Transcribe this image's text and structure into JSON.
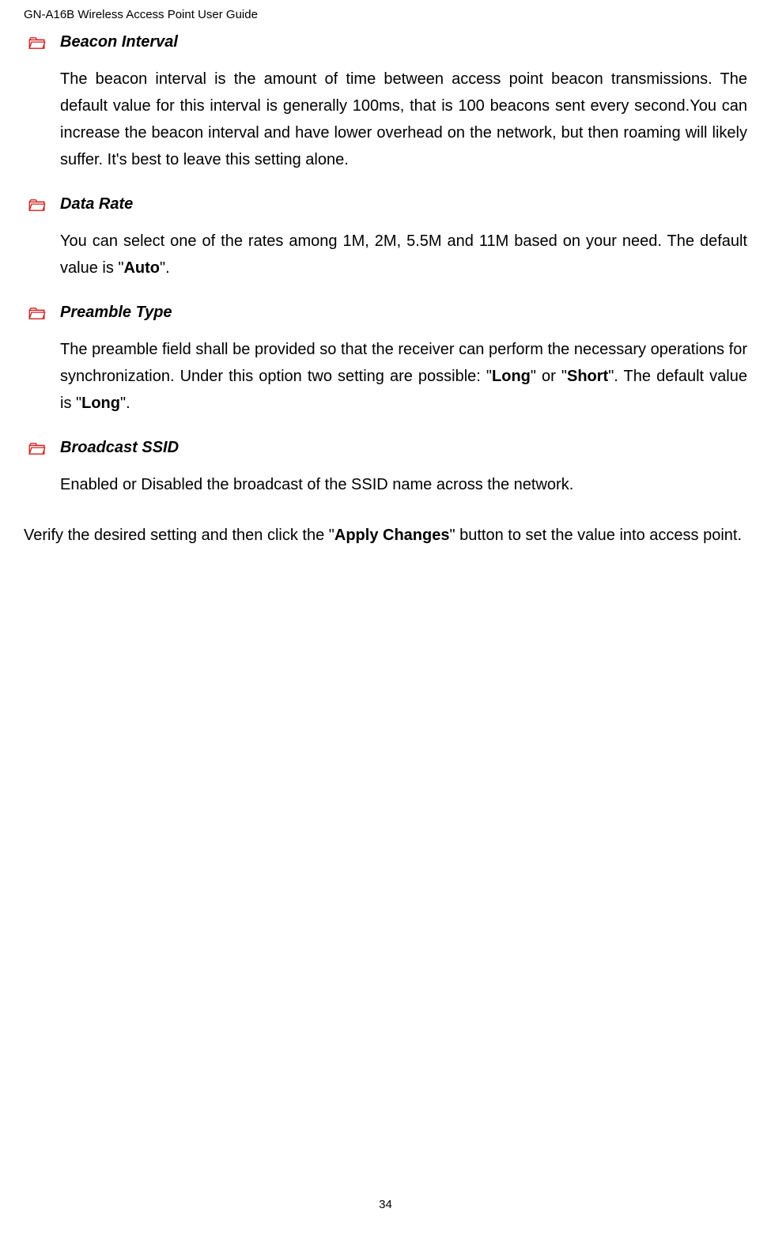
{
  "header": "GN-A16B Wireless Access Point  User Guide",
  "sections": [
    {
      "title": "Beacon Interval",
      "body_html": "The beacon interval is the amount of time between access point beacon transmissions. The default value for this interval is generally 100ms, that is 100 beacons sent every second.You can increase the beacon interval and have lower overhead on the network, but then roaming will likely suffer. It's best to leave this setting alone."
    },
    {
      "title": "Data Rate",
      "body_html": "You can select one of the rates among 1M, 2M, 5.5M and 11M based on your need. The default value is \"<span class=\"bold\">Auto</span>\"."
    },
    {
      "title": "Preamble Type",
      "body_html": "The preamble field shall be provided so that the receiver can perform the necessary operations for synchronization. Under this option two setting are possible: \"<span class=\"bold\">Long</span>\" or \"<span class=\"bold\">Short</span>\". The default value is \"<span class=\"bold\">Long</span>\"."
    },
    {
      "title": "Broadcast SSID",
      "body_html": "Enabled or Disabled the broadcast of the SSID name across the network."
    }
  ],
  "footer_html": "Verify the desired setting and then click the \"<span class=\"bold\">Apply Changes</span>\" button to set the value into access point.",
  "page_number": "34"
}
